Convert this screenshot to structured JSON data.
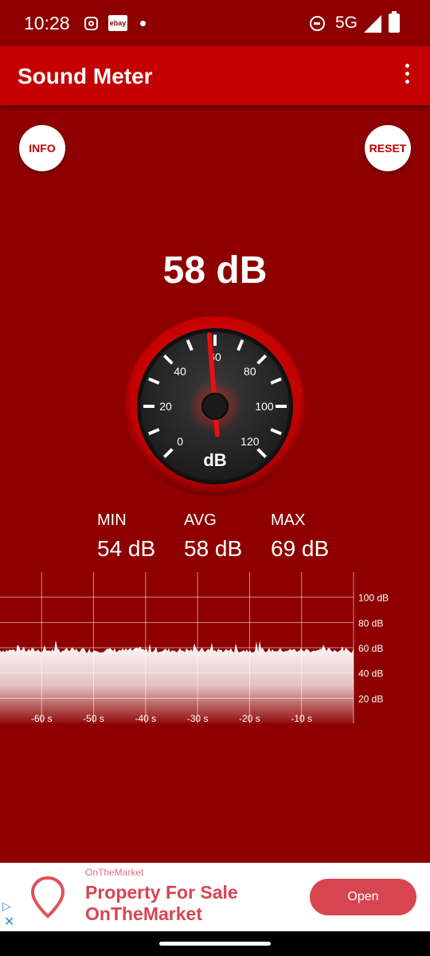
{
  "status_bar": {
    "time": "10:28",
    "ebay_label": "ebay",
    "network": "5G",
    "icons": [
      "instagram-icon",
      "ebay-icon",
      "notification-dot-icon",
      "do-not-disturb-icon",
      "signal-icon",
      "battery-icon"
    ]
  },
  "app_bar": {
    "title": "Sound Meter",
    "menu_icon": "more-vert-icon"
  },
  "buttons": {
    "info": "INFO",
    "reset": "RESET"
  },
  "reading": {
    "value": "58 dB"
  },
  "gauge": {
    "unit": "dB",
    "ticks": [
      "0",
      "20",
      "40",
      "60",
      "80",
      "100",
      "120"
    ],
    "min": 0,
    "max": 120,
    "needle_value": 58
  },
  "stats": {
    "min_label": "MIN",
    "min_value": "54 dB",
    "avg_label": "AVG",
    "avg_value": "58 dB",
    "max_label": "MAX",
    "max_value": "69 dB"
  },
  "chart_data": {
    "type": "area",
    "x_tick_labels": [
      "-60 s",
      "-50 s",
      "-40 s",
      "-30 s",
      "-20 s",
      "-10 s"
    ],
    "y_tick_labels": [
      "100 dB",
      "80 dB",
      "60 dB",
      "40 dB",
      "20 dB"
    ],
    "x_range": [
      -68,
      0
    ],
    "y_range": [
      0,
      120
    ],
    "approx_level_db": 58,
    "grid": true
  },
  "ad": {
    "brand": "OnTheMarket",
    "headline_line1": "Property For Sale",
    "headline_line2": "OnTheMarket",
    "cta": "Open",
    "ad_choice_icon": "ad-choices-icon",
    "close_icon": "close-icon"
  },
  "colors": {
    "background": "#8e0000",
    "app_bar": "#c40000",
    "accent": "#d64550"
  }
}
